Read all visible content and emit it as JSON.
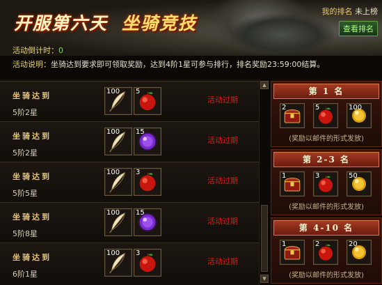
{
  "header": {
    "title": "开服第六天",
    "subtitle": "坐骑竞技",
    "my_rank_label": "我的排名",
    "my_rank_value": "未上榜",
    "view_rank_button": "查看排名"
  },
  "info": {
    "countdown_label": "活动倒计时：",
    "countdown_value": "0",
    "desc_label": "活动说明：",
    "desc_text": "坐骑达到要求即可领取奖励，达到4阶1星可参与排行，排名奖励23:59:00结算。"
  },
  "tasks": [
    {
      "name": "坐骑达到",
      "req": "5阶2星",
      "items": [
        {
          "icon": "feather-icon",
          "count": "100"
        },
        {
          "icon": "red-apple-icon",
          "count": "5"
        }
      ],
      "status": "活动过期"
    },
    {
      "name": "坐骑达到",
      "req": "5阶2星",
      "items": [
        {
          "icon": "feather-icon",
          "count": "100"
        },
        {
          "icon": "purple-orb-icon",
          "count": "15"
        }
      ],
      "status": "活动过期"
    },
    {
      "name": "坐骑达到",
      "req": "5阶5星",
      "items": [
        {
          "icon": "feather-icon",
          "count": "100"
        },
        {
          "icon": "red-apple-icon",
          "count": "3"
        }
      ],
      "status": "活动过期"
    },
    {
      "name": "坐骑达到",
      "req": "5阶8星",
      "items": [
        {
          "icon": "feather-icon",
          "count": "100"
        },
        {
          "icon": "purple-orb-icon",
          "count": "15"
        }
      ],
      "status": "活动过期"
    },
    {
      "name": "坐骑达到",
      "req": "6阶1星",
      "items": [
        {
          "icon": "feather-icon",
          "count": "100"
        },
        {
          "icon": "red-apple-icon",
          "count": "3"
        }
      ],
      "status": "活动过期"
    }
  ],
  "ranks": [
    {
      "title": "第 1 名",
      "items": [
        {
          "icon": "treasure-chest-icon",
          "count": "2"
        },
        {
          "icon": "red-apple-icon",
          "count": "5"
        },
        {
          "icon": "gold-orb-icon",
          "count": "100"
        }
      ],
      "note": "(奖励以邮件的形式发放)"
    },
    {
      "title": "第 2-3 名",
      "items": [
        {
          "icon": "treasure-chest-icon",
          "count": "1"
        },
        {
          "icon": "red-apple-icon",
          "count": "3"
        },
        {
          "icon": "gold-orb-icon",
          "count": "50"
        }
      ],
      "note": "(奖励以邮件的形式发放)"
    },
    {
      "title": "第 4-10 名",
      "items": [
        {
          "icon": "treasure-chest-icon",
          "count": "1"
        },
        {
          "icon": "red-apple-icon",
          "count": "2"
        },
        {
          "icon": "gold-orb-icon",
          "count": "20"
        }
      ],
      "note": "(奖励以邮件的形式发放)"
    }
  ],
  "colors": {
    "expired": "#e21a1a",
    "countdown_value": "#58e94c",
    "accent_gold": "#e6c57a"
  }
}
